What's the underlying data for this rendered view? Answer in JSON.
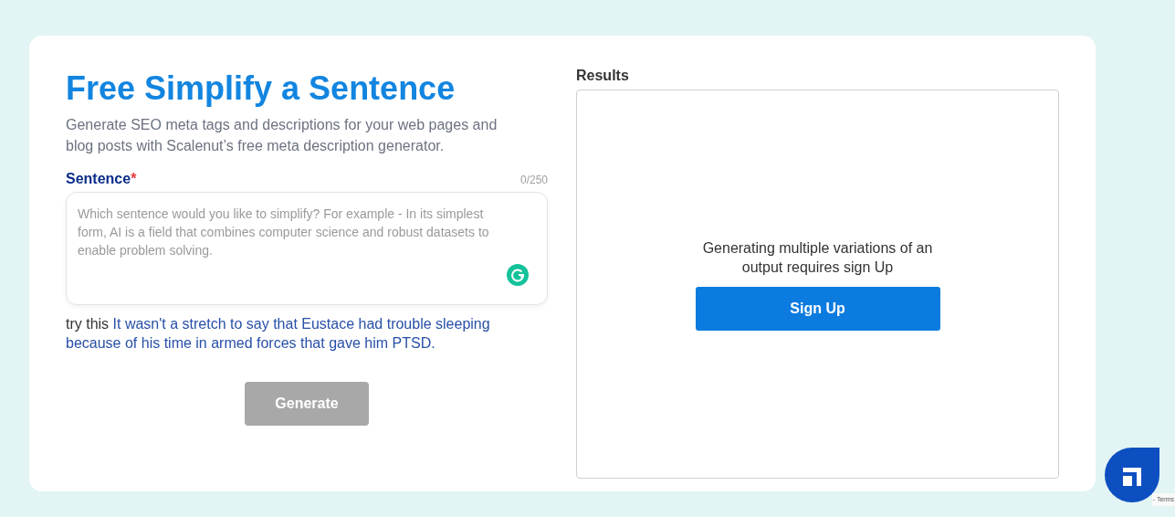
{
  "form": {
    "title": "Free Simplify a Sentence",
    "description": "Generate SEO meta tags and descriptions for your web pages and blog posts with Scalenut’s free meta description generator.",
    "field": {
      "label": "Sentence",
      "required_mark": "*",
      "counter": "0/250",
      "placeholder": "Which sentence would you like to simplify? For example - In its simplest form, AI is a field that combines computer science and robust datasets to enable problem solving."
    },
    "suggestion": {
      "prefix": "try this",
      "example": "It wasn't a stretch to say that Eustace had trouble sleeping because of his time in armed forces that gave him PTSD."
    },
    "generate_button": {
      "label": "Generate",
      "disabled": true
    }
  },
  "results": {
    "label": "Results",
    "message": "Generating multiple variations of an output requires sign Up",
    "button": "Sign Up"
  },
  "recaptcha": {
    "text": "- Terms"
  }
}
